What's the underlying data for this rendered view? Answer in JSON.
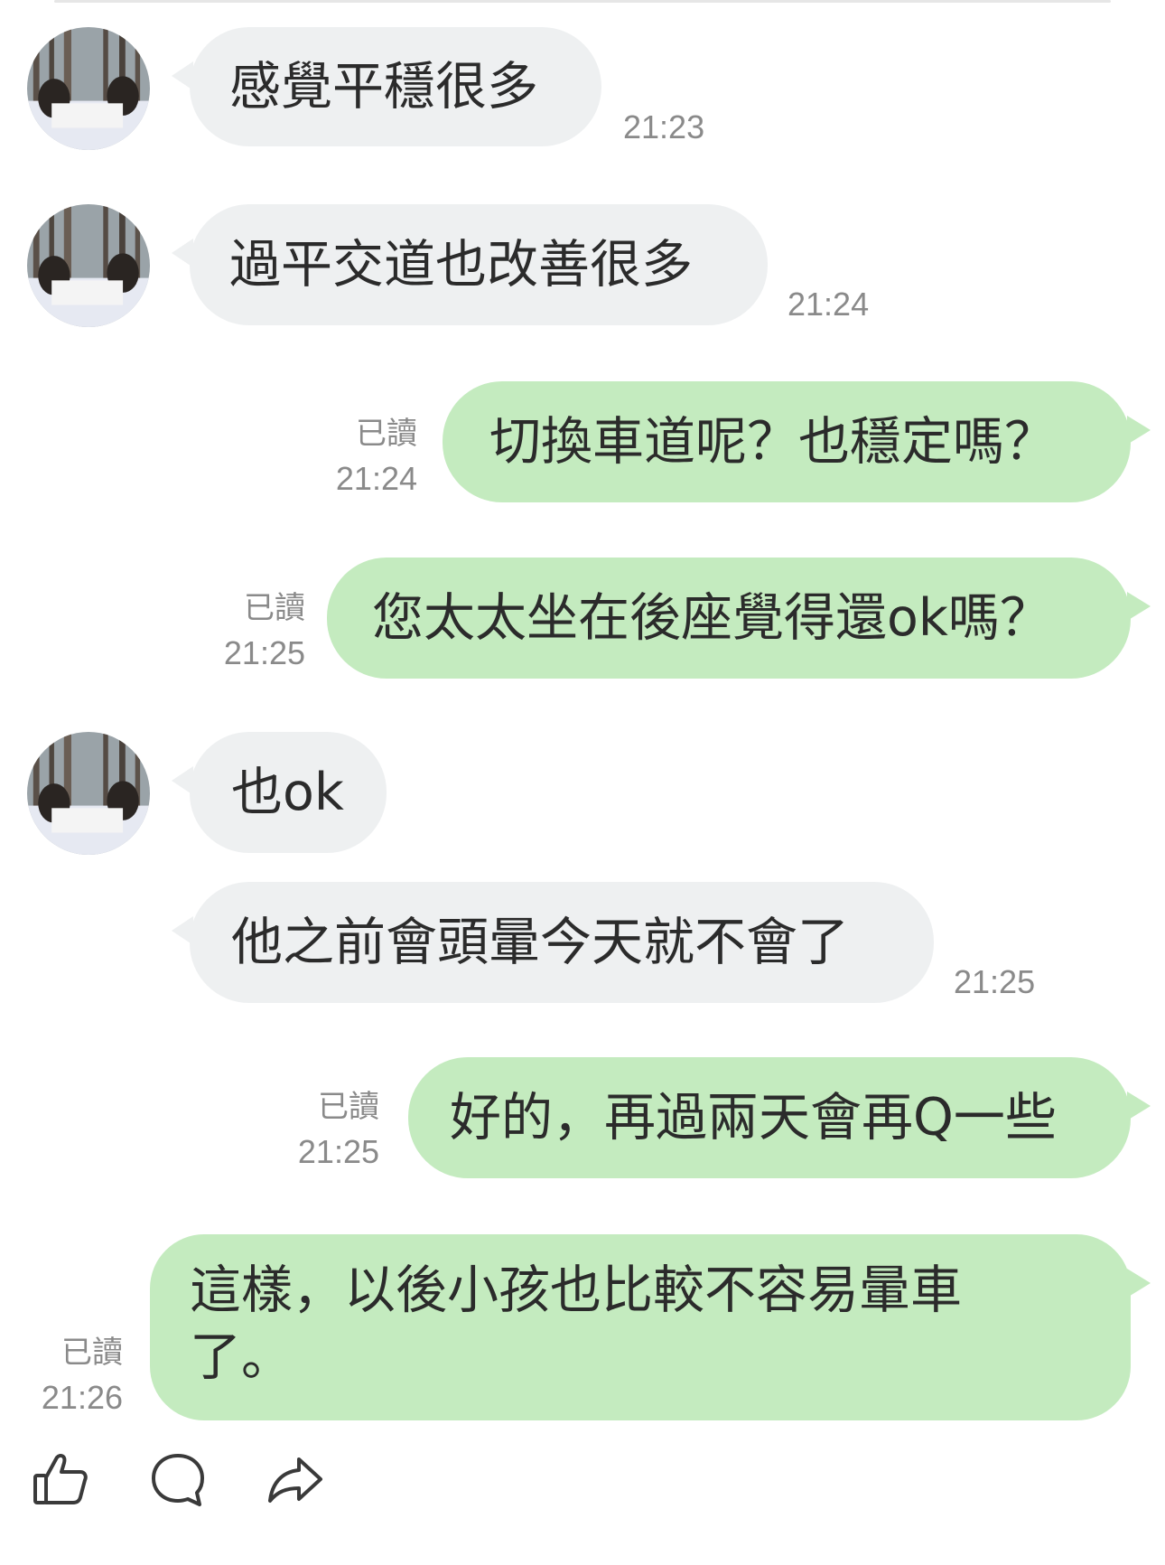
{
  "messages": [
    {
      "side": "in",
      "text": "感覺平穩很多",
      "time": "21:23"
    },
    {
      "side": "in",
      "text": "過平交道也改善很多",
      "time": "21:24"
    },
    {
      "side": "out",
      "text": "切換車道呢？也穩定嗎？",
      "read": "已讀",
      "time": "21:24"
    },
    {
      "side": "out",
      "text": "您太太坐在後座覺得還ok嗎？",
      "read": "已讀",
      "time": "21:25"
    },
    {
      "side": "in",
      "text": "也ok",
      "time": ""
    },
    {
      "side": "in",
      "text": "他之前會頭暈今天就不會了",
      "time": "21:25"
    },
    {
      "side": "out",
      "text": "好的，再過兩天會再Q一些",
      "read": "已讀",
      "time": "21:25"
    },
    {
      "side": "out",
      "text_line1": "這樣，以後小孩也比較不容易暈車",
      "text_line2": "了。",
      "read": "已讀",
      "time": "21:26"
    }
  ],
  "actions": [
    {
      "icon": "thumbs-up-icon"
    },
    {
      "icon": "comment-icon"
    },
    {
      "icon": "share-icon"
    }
  ],
  "colors": {
    "incoming_bubble": "#eef0f1",
    "outgoing_bubble": "#c4ebbf",
    "meta_text": "#8a8a8a"
  }
}
